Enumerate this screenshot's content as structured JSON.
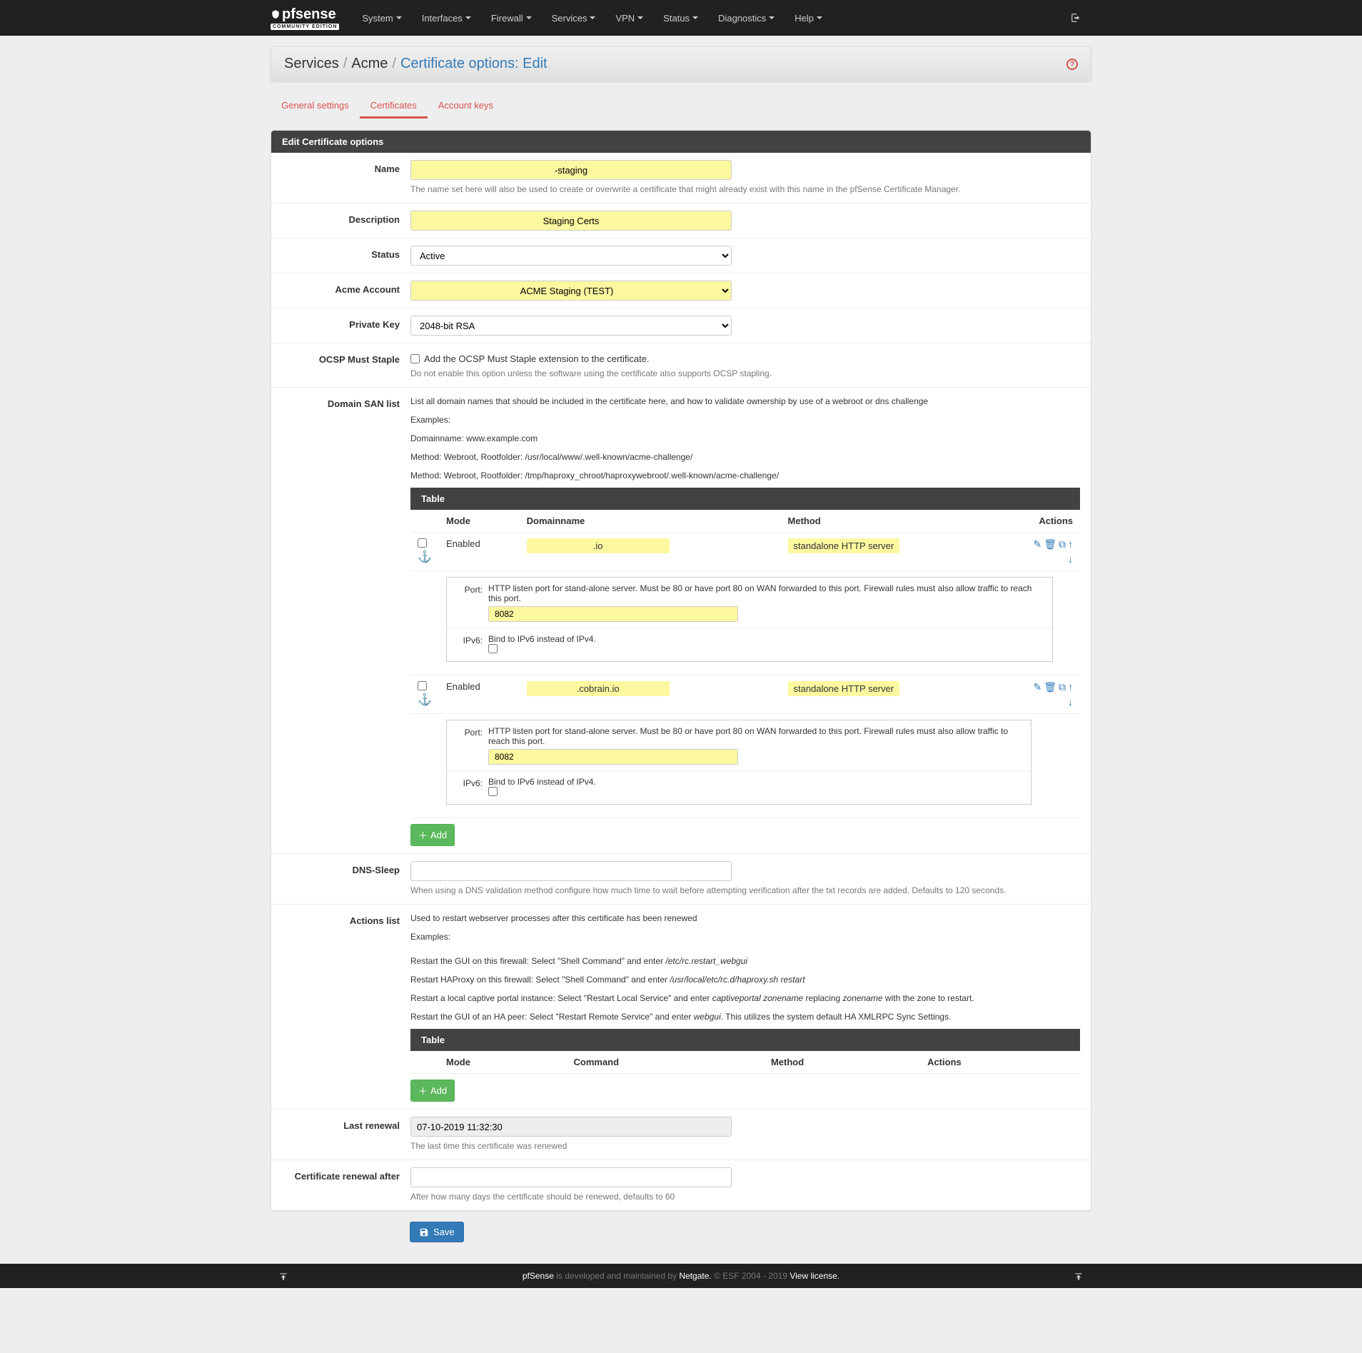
{
  "nav": {
    "logo_main": "pfsense",
    "logo_sub": "COMMUNITY EDITION",
    "items": [
      "System",
      "Interfaces",
      "Firewall",
      "Services",
      "VPN",
      "Status",
      "Diagnostics",
      "Help"
    ]
  },
  "breadcrumb": {
    "parts": [
      "Services",
      "Acme"
    ],
    "active": "Certificate options: Edit"
  },
  "tabs": [
    "General settings",
    "Certificates",
    "Account keys"
  ],
  "panel_title": "Edit Certificate options",
  "labels": {
    "name": "Name",
    "description": "Description",
    "status": "Status",
    "acme_account": "Acme Account",
    "private_key": "Private Key",
    "ocsp": "OCSP Must Staple",
    "domain_san": "Domain SAN list",
    "dns_sleep": "DNS-Sleep",
    "actions_list": "Actions list",
    "last_renewal": "Last renewal",
    "renewal_after": "Certificate renewal after"
  },
  "fields": {
    "name_value": "-staging",
    "name_help": "The name set here will also be used to create or overwrite a certificate that might already exist with this name in the pfSense Certificate Manager.",
    "description_value": "Staging Certs",
    "status_value": "Active",
    "acme_account_value": "ACME Staging (TEST)",
    "private_key_value": "2048-bit RSA",
    "ocsp_label": "Add the OCSP Must Staple extension to the certificate.",
    "ocsp_help": "Do not enable this option unless the software using the certificate also supports OCSP stapling.",
    "last_renewal_value": "07-10-2019 11:32:30",
    "last_renewal_help": "The last time this certificate was renewed",
    "renewal_after_value": "",
    "renewal_after_help": "After how many days the certificate should be renewed, defaults to 60",
    "dns_sleep_value": "",
    "dns_sleep_help": "When using a DNS validation method configure how much time to wait before attempting verification after the txt records are added. Defaults to 120 seconds."
  },
  "san_help": {
    "line1": "List all domain names that should be included in the certificate here, and how to validate ownership by use of a webroot or dns challenge",
    "line2": "Examples:",
    "line3": "Domainname: www.example.com",
    "line4": "Method: Webroot, Rootfolder: /usr/local/www/.well-known/acme-challenge/",
    "line5": "Method: Webroot, Rootfolder: /tmp/haproxy_chroot/haproxywebroot/.well-known/acme-challenge/"
  },
  "san_table": {
    "title": "Table",
    "headers": {
      "mode": "Mode",
      "domain": "Domainname",
      "method": "Method",
      "actions": "Actions"
    },
    "rows": [
      {
        "mode": "Enabled",
        "domain": ".io",
        "method": "standalone HTTP server",
        "port_value": "8082"
      },
      {
        "mode": "Enabled",
        "domain": ".cobrain.io",
        "method": "standalone HTTP server",
        "port_value": "8082"
      }
    ],
    "sub": {
      "port_label": "Port:",
      "port_help": "HTTP listen port for stand-alone server. Must be 80 or have port 80 on WAN forwarded to this port. Firewall rules must also allow traffic to reach this port.",
      "ipv6_label": "IPv6:",
      "ipv6_help": "Bind to IPv6 instead of IPv4."
    }
  },
  "actions_help": {
    "line1": "Used to restart webserver processes after this certificate has been renewed",
    "line2": "Examples:",
    "line3a": "Restart the GUI on this firewall: Select \"Shell Command\" and enter ",
    "line3b": "/etc/rc.restart_webgui",
    "line4a": "Restart HAProxy on this firewall: Select \"Shell Command\" and enter ",
    "line4b": "/usr/local/etc/rc.d/haproxy.sh restart",
    "line5a": "Restart a local captive portal instance: Select \"Restart Local Service\" and enter ",
    "line5b": "captiveportal zonename",
    "line5c": " replacing ",
    "line5d": "zonename",
    "line5e": " with the zone to restart.",
    "line6a": "Restart the GUI of an HA peer: Select \"Restart Remote Service\" and enter ",
    "line6b": "webgui",
    "line6c": ". This utilizes the system default HA XMLRPC Sync Settings."
  },
  "actions_table": {
    "title": "Table",
    "headers": {
      "mode": "Mode",
      "command": "Command",
      "method": "Method",
      "actions": "Actions"
    }
  },
  "buttons": {
    "add": "Add",
    "save": "Save"
  },
  "footer": {
    "t1": "pfSense",
    "t2": " is developed and maintained by ",
    "t3": "Netgate.",
    "t4": " © ESF 2004 - 2019 ",
    "t5": "View license."
  }
}
